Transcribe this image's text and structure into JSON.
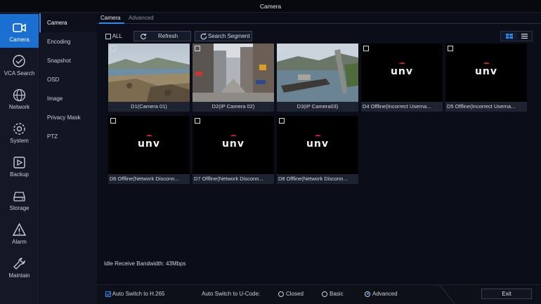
{
  "window": {
    "title": "Camera"
  },
  "nav": {
    "items": [
      {
        "label": "Camera",
        "icon": "camera-icon",
        "active": true
      },
      {
        "label": "VCA Search",
        "icon": "vca-search-icon",
        "active": false
      },
      {
        "label": "Network",
        "icon": "globe-icon",
        "active": false
      },
      {
        "label": "System",
        "icon": "gear-icon",
        "active": false
      },
      {
        "label": "Backup",
        "icon": "backup-icon",
        "active": false
      },
      {
        "label": "Storage",
        "icon": "storage-icon",
        "active": false
      },
      {
        "label": "Alarm",
        "icon": "alarm-icon",
        "active": false
      },
      {
        "label": "Maintain",
        "icon": "wrench-icon",
        "active": false
      }
    ]
  },
  "subnav": {
    "items": [
      {
        "label": "Camera",
        "active": true
      },
      {
        "label": "Encoding",
        "active": false
      },
      {
        "label": "Snapshot",
        "active": false
      },
      {
        "label": "OSD",
        "active": false
      },
      {
        "label": "Image",
        "active": false
      },
      {
        "label": "Privacy Mask",
        "active": false
      },
      {
        "label": "PTZ",
        "active": false
      }
    ]
  },
  "tabs": [
    {
      "label": "Camera",
      "active": true
    },
    {
      "label": "Advanced",
      "active": false
    }
  ],
  "toolbar": {
    "all_label": "ALL",
    "refresh_label": "Refresh",
    "search_label": "Search Segment"
  },
  "view_toggle": {
    "selected": "grid",
    "icons": [
      "grid-view-icon",
      "list-view-icon"
    ]
  },
  "cameras": [
    {
      "caption": "D1(Camera 01)",
      "online": true
    },
    {
      "caption": "D2(IP Camera 02)",
      "online": true
    },
    {
      "caption": "D3(IP Camera03)",
      "online": true
    },
    {
      "caption": "D4 Offline(Incorrect Userna...",
      "online": false,
      "logo": "unv"
    },
    {
      "caption": "D5 Offline(Incorrect Userna...",
      "online": false,
      "logo": "unv"
    },
    {
      "caption": "D6 Offline(Network Disconn...",
      "online": false,
      "logo": "unv"
    },
    {
      "caption": "D7 Offline(Network Disconn...",
      "online": false,
      "logo": "unv"
    },
    {
      "caption": "D8 Offline(Network Disconn...",
      "online": false,
      "logo": "unv"
    }
  ],
  "status": {
    "bandwidth": "Idle Receive Bandwidth: 43Mbps"
  },
  "bottom": {
    "auto_h265_label": "Auto Switch to H.265",
    "auto_h265_checked": true,
    "ucode_label": "Auto Switch to U-Code:",
    "ucode_options": [
      "Closed",
      "Basic",
      "Advanced"
    ],
    "ucode_selected": "Advanced",
    "exit_label": "Exit"
  },
  "colors": {
    "accent": "#1b6fd0",
    "highlight": "#2a8bf0",
    "logo_red": "#d0202a"
  }
}
